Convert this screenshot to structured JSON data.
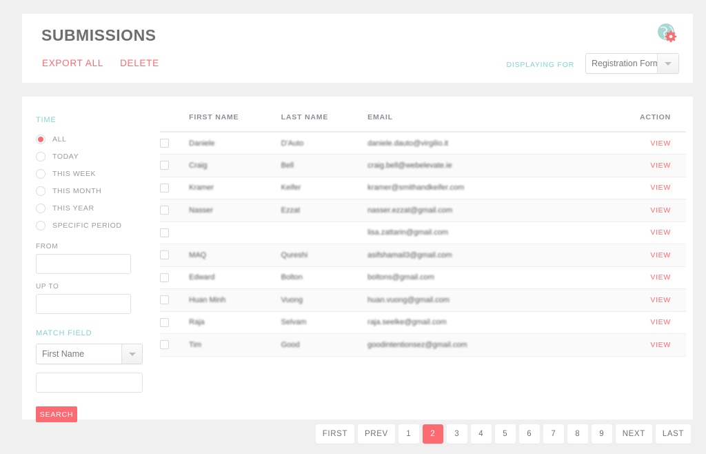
{
  "header": {
    "title": "SUBMISSIONS",
    "export_all_label": "EXPORT ALL",
    "delete_label": "DELETE",
    "displaying_for_label": "DISPLAYING FOR",
    "form_select_value": "Registration Form",
    "avatar_icon": "globe-gear-avatar-icon",
    "accent_color": "#fc6b71",
    "teal_color": "#86d2ce"
  },
  "sidebar": {
    "time_group_title": "TIME",
    "time_options": [
      {
        "label": "ALL",
        "selected": true
      },
      {
        "label": "TODAY",
        "selected": false
      },
      {
        "label": "THIS WEEK",
        "selected": false
      },
      {
        "label": "THIS MONTH",
        "selected": false
      },
      {
        "label": "THIS YEAR",
        "selected": false
      },
      {
        "label": "SPECIFIC PERIOD",
        "selected": false
      }
    ],
    "from_label": "FROM",
    "from_value": "",
    "from_placeholder": "",
    "up_to_label": "UP TO",
    "up_to_value": "",
    "up_to_placeholder": "",
    "match_field_title": "MATCH FIELD",
    "match_field_select_value": "First Name",
    "match_field_input_value": "",
    "match_field_input_placeholder": "",
    "search_button_label": "SEARCH"
  },
  "table": {
    "columns": [
      "FIRST NAME",
      "LAST NAME",
      "EMAIL",
      "ACTION"
    ],
    "action_label": "VIEW",
    "rows": [
      {
        "first": "Daniele",
        "last": "D'Auto",
        "email": "daniele.dauto@virgilio.it"
      },
      {
        "first": "Craig",
        "last": "Bell",
        "email": "craig.bell@webelevate.ie"
      },
      {
        "first": "Kramer",
        "last": "Keifer",
        "email": "kramer@smithandkeifer.com"
      },
      {
        "first": "Nasser",
        "last": "Ezzat",
        "email": "nasser.ezzat@gmail.com"
      },
      {
        "first": "",
        "last": "",
        "email": "lisa.zattarin@gmail.com"
      },
      {
        "first": "MAQ",
        "last": "Qureshi",
        "email": "asifshamail3@gmail.com"
      },
      {
        "first": "Edward",
        "last": "Bolton",
        "email": "boltons@gmail.com"
      },
      {
        "first": "Huan Minh",
        "last": "Vuong",
        "email": "huan.vuong@gmail.com"
      },
      {
        "first": "Raja",
        "last": "Selvam",
        "email": "raja.seelke@gmail.com"
      },
      {
        "first": "Tim",
        "last": "Good",
        "email": "goodintentionsez@gmail.com"
      }
    ]
  },
  "pagination": {
    "first_label": "FIRST",
    "prev_label": "PREV",
    "next_label": "NEXT",
    "last_label": "LAST",
    "pages": [
      "1",
      "2",
      "3",
      "4",
      "5",
      "6",
      "7",
      "8",
      "9"
    ],
    "active_page": "2"
  }
}
